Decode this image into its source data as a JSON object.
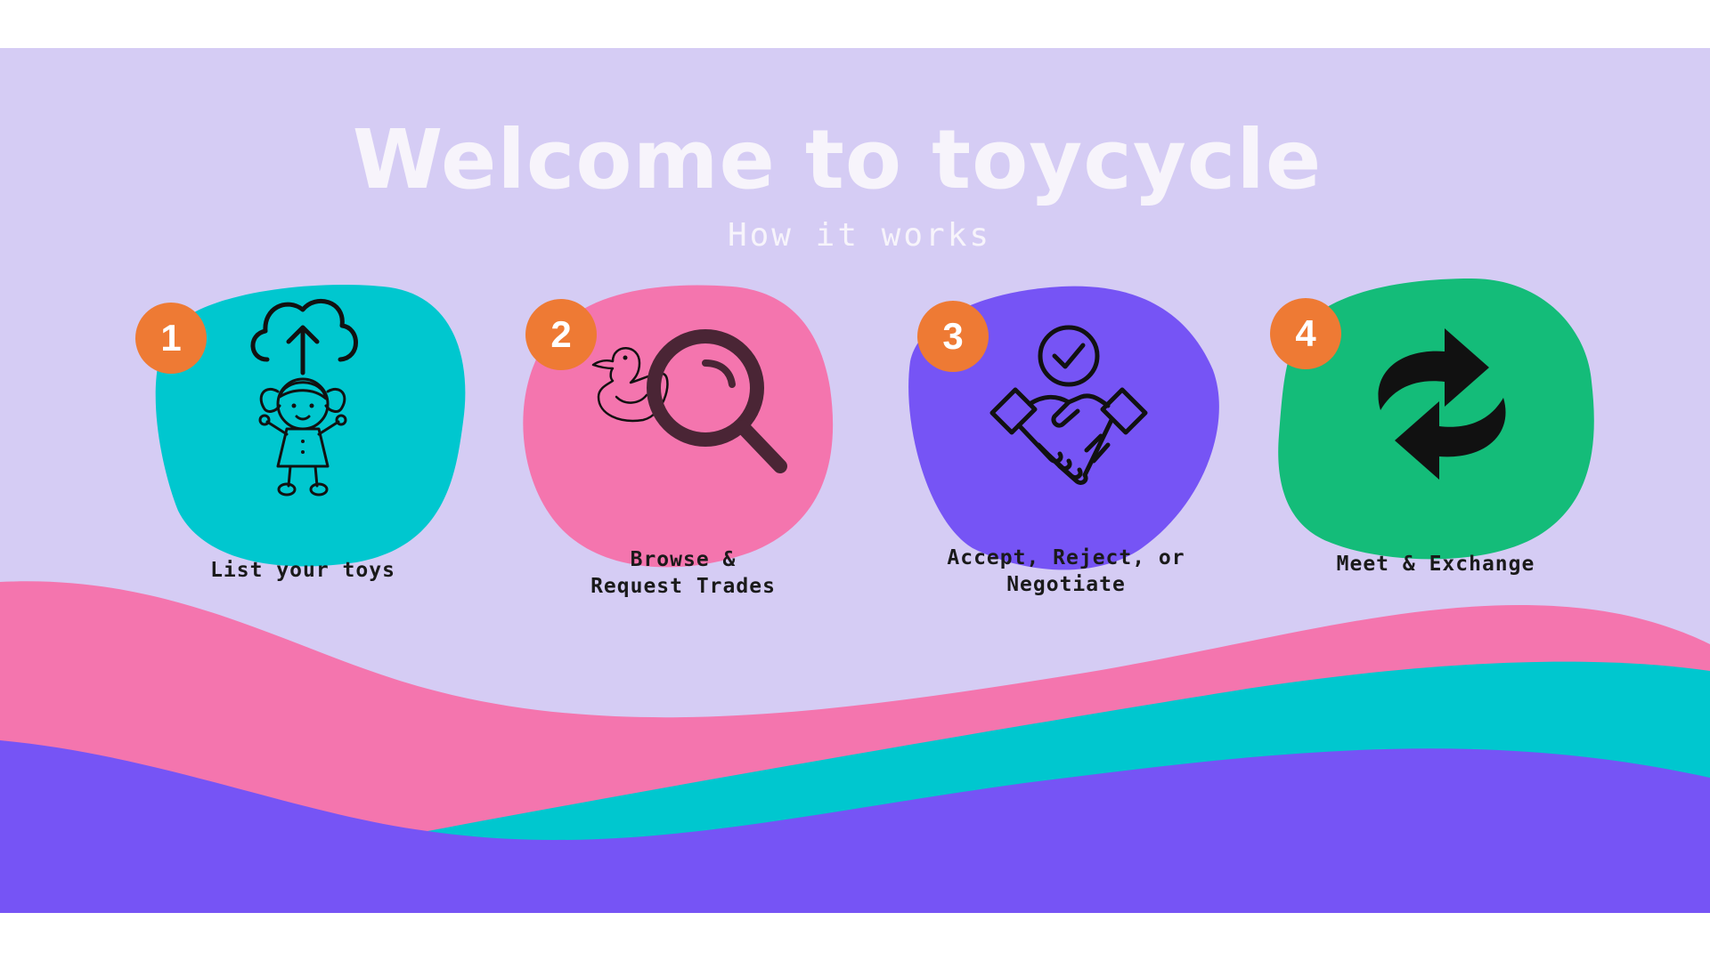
{
  "page": {
    "title": "Welcome to toycycle",
    "subtitle": "How it works"
  },
  "steps": [
    {
      "number": "1",
      "label": "List your toys",
      "icon": "cloud-upload-doll-icon",
      "color": "#00C7CF"
    },
    {
      "number": "2",
      "label_lines": [
        "Browse &",
        "Request Trades"
      ],
      "icon": "duck-magnifier-icon",
      "color": "#F475AE"
    },
    {
      "number": "3",
      "label_lines": [
        "Accept, Reject, or",
        "Negotiate"
      ],
      "icon": "handshake-check-icon",
      "color": "#7654F5"
    },
    {
      "number": "4",
      "label": "Meet & Exchange",
      "icon": "exchange-arrows-icon",
      "color": "#14BC79"
    }
  ],
  "colors": {
    "background": "#D5CCF4",
    "badge": "#EE7A34",
    "wave_pink": "#F475AE",
    "wave_teal": "#00C7CF",
    "wave_purple": "#7654F5",
    "title_text": "#F7F4FB"
  }
}
